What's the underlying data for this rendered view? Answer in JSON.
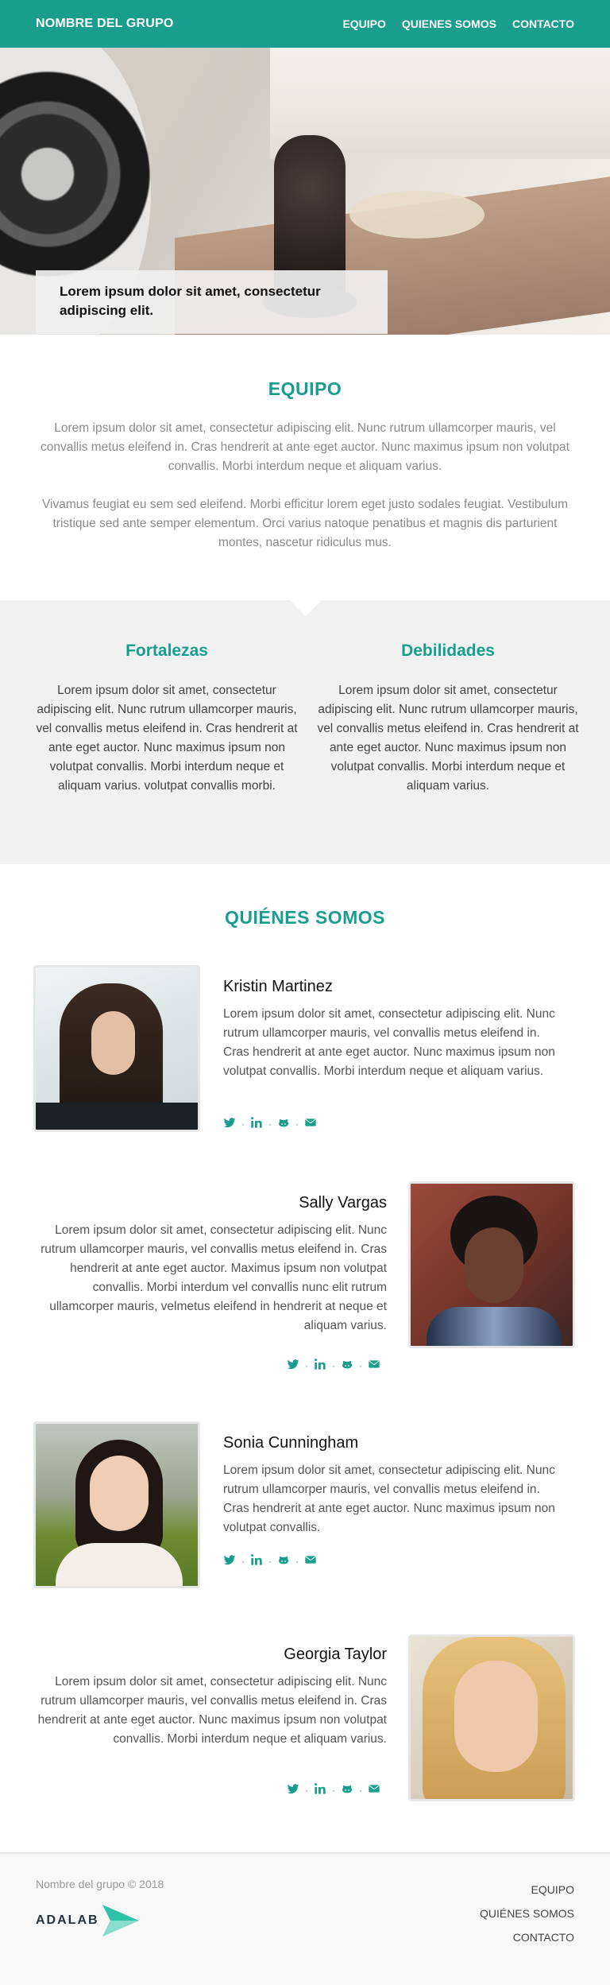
{
  "header": {
    "brand": "NOMBRE DEL GRUPO",
    "nav": [
      "EQUIPO",
      "QUIENES SOMOS",
      "CONTACTO"
    ]
  },
  "hero": {
    "caption": "Lorem ipsum dolor sit amet, consectetur adipiscing elit."
  },
  "equipo": {
    "title": "EQUIPO",
    "p1": "Lorem ipsum dolor sit amet, consectetur adipiscing elit. Nunc rutrum ullamcorper mauris, vel convallis metus eleifend in. Cras hendrerit at ante eget auctor. Nunc maximus ipsum non volutpat convallis. Morbi interdum neque et aliquam varius.",
    "p2": "Vivamus feugiat eu sem sed eleifend. Morbi efficitur lorem eget justo sodales feugiat. Vestibulum tristique sed ante semper elementum. Orci varius natoque penatibus et magnis dis parturient montes, nascetur ridiculus mus."
  },
  "fd": {
    "left_title": "Fortalezas",
    "left_text": "Lorem ipsum dolor sit amet, consectetur adipiscing elit. Nunc rutrum ullamcorper mauris, vel convallis metus eleifend in. Cras hendrerit at ante eget auctor. Nunc maximus ipsum non volutpat convallis. Morbi interdum neque et aliquam varius. volutpat convallis morbi.",
    "right_title": "Debilidades",
    "right_text": "Lorem ipsum dolor sit amet, consectetur adipiscing elit. Nunc rutrum ullamcorper mauris, vel convallis metus eleifend in. Cras hendrerit at ante eget auctor. Nunc maximus ipsum non volutpat convallis. Morbi interdum neque et aliquam varius."
  },
  "quienes": {
    "title": "QUIÉNES SOMOS",
    "members": [
      {
        "name": "Kristin Martinez",
        "bio": "Lorem ipsum dolor sit amet, consectetur adipiscing elit. Nunc rutrum ullamcorper mauris, vel convallis metus eleifend in. Cras hendrerit at ante eget auctor. Nunc maximus ipsum non volutpat convallis. Morbi interdum neque et aliquam varius."
      },
      {
        "name": "Sally Vargas",
        "bio": "Lorem ipsum dolor sit amet, consectetur adipiscing elit. Nunc rutrum ullamcorper mauris, vel convallis metus eleifend in. Cras hendrerit at ante eget auctor. Maximus ipsum non volutpat convallis. Morbi interdum  vel convallis nunc elit rutrum ullamcorper mauris, velmetus eleifend in hendrerit at neque et aliquam varius."
      },
      {
        "name": "Sonia Cunningham",
        "bio": "Lorem ipsum dolor sit amet, consectetur adipiscing elit. Nunc rutrum ullamcorper mauris, vel convallis metus eleifend in. Cras hendrerit at ante eget auctor. Nunc maximus ipsum non volutpat convallis."
      },
      {
        "name": "Georgia Taylor",
        "bio": "Lorem ipsum dolor sit amet, consectetur adipiscing elit. Nunc rutrum ullamcorper mauris, vel convallis metus eleifend in. Cras hendrerit at ante eget auctor. Nunc maximus ipsum non volutpat convallis. Morbi interdum neque et aliquam varius."
      }
    ],
    "social_icons": [
      "twitter-icon",
      "linkedin-icon",
      "github-icon",
      "envelope-icon"
    ],
    "separator": "·"
  },
  "footer": {
    "copy": "Nombre del grupo © 2018",
    "logo_text": "ADALAB",
    "links": [
      "EQUIPO",
      "QUIÉNES SOMOS",
      "CONTACTO"
    ]
  },
  "colors": {
    "accent": "#199e8d",
    "section_bg": "#f1f1f1"
  }
}
